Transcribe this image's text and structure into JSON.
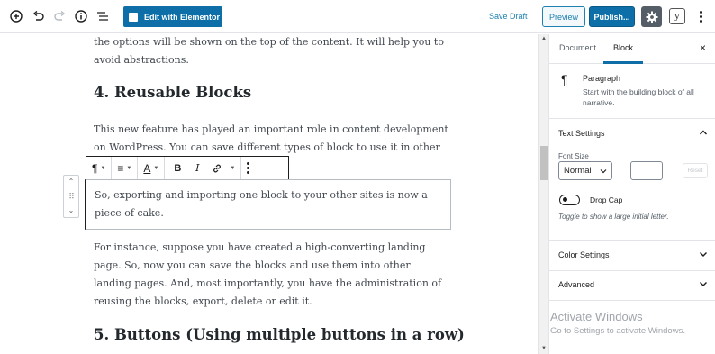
{
  "toolbar": {
    "elementor_label": "Edit with Elementor",
    "save_draft_label": "Save Draft",
    "preview_label": "Preview",
    "publish_label": "Publish...",
    "yoast_label": "y",
    "icons": [
      "add-block-icon",
      "undo-icon",
      "redo-icon",
      "info-icon",
      "block-navigation-icon",
      "gear-icon",
      "yoast-icon",
      "more-options-icon"
    ]
  },
  "content": {
    "para_top": "the options will be shown on the top of the content. It will help you to avoid abstractions.",
    "heading_4": "4. Reusable Blocks",
    "para_reusable": "This new feature has played an important role in content development on WordPress. You can save different types of block to use it in other related",
    "block_toolbar": {
      "paragraph_icon": "¶",
      "align_icon": "≡",
      "text_color_icon": "A",
      "bold_label": "B",
      "italic_label": "I"
    },
    "selected_block_text": "So, exporting and importing one block to your other sites is now a piece of cake.",
    "para_instance": "For instance, suppose you have created a high-converting landing page. So, now you can save the blocks and use them into other landing pages. And, most importantly, you have the administration of reusing the blocks, export, delete or edit it.",
    "heading_5": "5. Buttons (Using multiple buttons in a row)"
  },
  "sidebar": {
    "tabs": [
      {
        "label": "Document",
        "active": false
      },
      {
        "label": "Block",
        "active": true
      }
    ],
    "close_label": "×",
    "block_card": {
      "icon": "¶",
      "title": "Paragraph",
      "description": "Start with the building block of all narrative."
    },
    "text_settings": {
      "title": "Text Settings",
      "font_size_label": "Font Size",
      "font_size_value": "Normal",
      "reset_label": "Reset",
      "drop_cap_label": "Drop Cap",
      "drop_cap_help": "Toggle to show a large initial letter.",
      "drop_cap_enabled": false
    },
    "color_settings_title": "Color Settings",
    "advanced_title": "Advanced"
  },
  "watermark": {
    "title": "Activate Windows",
    "subtitle": "Go to Settings to activate Windows."
  },
  "colors": {
    "accent": "#0e6fa8",
    "link": "#1e81b0",
    "text": "#40464d"
  }
}
